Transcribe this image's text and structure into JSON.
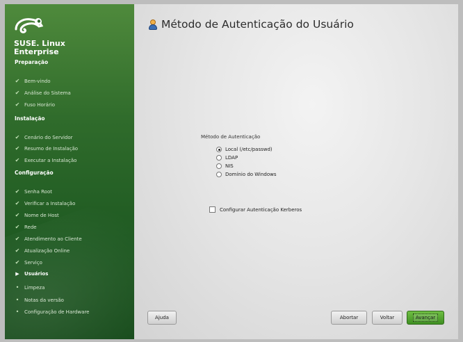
{
  "sidebar": {
    "brand_line1": "SUSE. Linux",
    "brand_line2": "Enterprise",
    "sections": [
      {
        "label": "Preparação"
      },
      {
        "label": "Instalação"
      },
      {
        "label": "Configuração"
      }
    ],
    "steps": [
      {
        "label": "Bem-vindo",
        "state": "done"
      },
      {
        "label": "Análise do Sistema",
        "state": "done"
      },
      {
        "label": "Fuso Horário",
        "state": "done"
      },
      {
        "label": "Cenário do Servidor",
        "state": "done"
      },
      {
        "label": "Resumo de Instalação",
        "state": "done"
      },
      {
        "label": "Executar a Instalação",
        "state": "done"
      },
      {
        "label": "Senha Root",
        "state": "done"
      },
      {
        "label": "Verificar a Instalação",
        "state": "done"
      },
      {
        "label": "Nome de Host",
        "state": "done"
      },
      {
        "label": "Rede",
        "state": "done"
      },
      {
        "label": "Atendimento ao Cliente",
        "state": "done"
      },
      {
        "label": "Atualização Online",
        "state": "done"
      },
      {
        "label": "Serviço",
        "state": "done"
      },
      {
        "label": "Usuários",
        "state": "current"
      },
      {
        "label": "Limpeza",
        "state": "todo"
      },
      {
        "label": "Notas da versão",
        "state": "todo"
      },
      {
        "label": "Configuração de Hardware",
        "state": "todo"
      }
    ]
  },
  "main": {
    "title": "Método de Autenticação do Usuário",
    "auth_group_label": "Método de Autenticação",
    "auth_options": [
      {
        "label": "Local (/etc/passwd)",
        "selected": true
      },
      {
        "label": "LDAP",
        "selected": false
      },
      {
        "label": "NIS",
        "selected": false
      },
      {
        "label": "Domínio do Windows",
        "selected": false
      }
    ],
    "kerberos_label": "Configurar Autenticação Kerberos",
    "kerberos_checked": false
  },
  "buttons": {
    "help": "Ajuda",
    "abort": "Abortar",
    "back": "Voltar",
    "next": "Avançar"
  },
  "colors": {
    "sidebar_green": "#2f6b2b",
    "next_button_green": "#4f9f2d"
  }
}
